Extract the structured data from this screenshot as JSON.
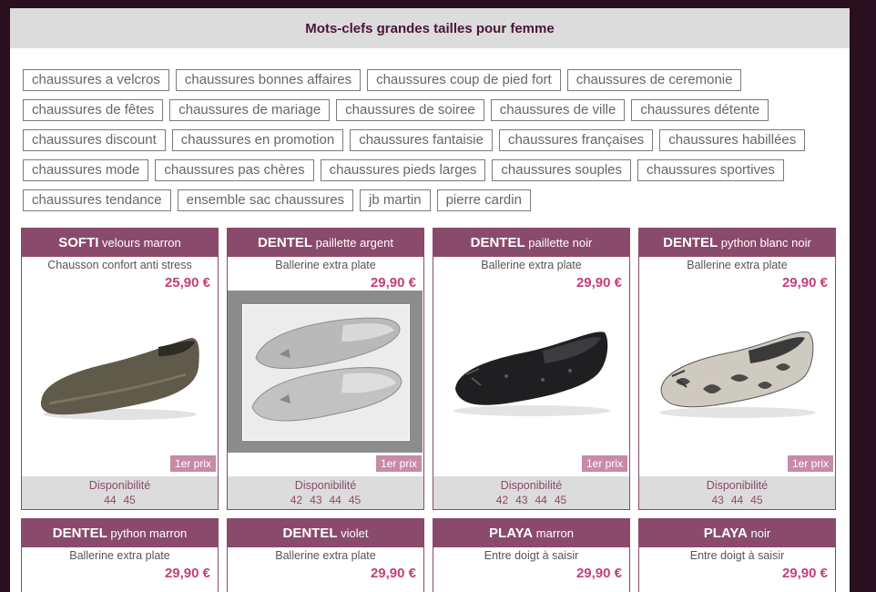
{
  "header": {
    "title": "Mots-clefs grandes tailles pour femme"
  },
  "tags": [
    "chaussures a velcros",
    "chaussures bonnes affaires",
    "chaussures coup de pied fort",
    "chaussures de ceremonie",
    "chaussures de fêtes",
    "chaussures de mariage",
    "chaussures de soiree",
    "chaussures de ville",
    "chaussures détente",
    "chaussures discount",
    "chaussures en promotion",
    "chaussures fantaisie",
    "chaussures françaises",
    "chaussures habillées",
    "chaussures mode",
    "chaussures pas chères",
    "chaussures pieds larges",
    "chaussures souples",
    "chaussures sportives",
    "chaussures tendance",
    "ensemble sac chaussures",
    "jb martin",
    "pierre cardin"
  ],
  "products": [
    {
      "brand": "SOFTI",
      "variant": "velours marron",
      "subtitle": "Chausson confort anti stress",
      "price": "25,90 €",
      "badge": "1er prix",
      "availability_label": "Disponibilité",
      "sizes": [
        "44",
        "45"
      ]
    },
    {
      "brand": "DENTEL",
      "variant": "paillette argent",
      "subtitle": "Ballerine extra plate",
      "price": "29,90 €",
      "badge": "1er prix",
      "availability_label": "Disponibilité",
      "sizes": [
        "42",
        "43",
        "44",
        "45"
      ]
    },
    {
      "brand": "DENTEL",
      "variant": "paillette noir",
      "subtitle": "Ballerine extra plate",
      "price": "29,90 €",
      "badge": "1er prix",
      "availability_label": "Disponibilité",
      "sizes": [
        "42",
        "43",
        "44",
        "45"
      ]
    },
    {
      "brand": "DENTEL",
      "variant": "python blanc noir",
      "subtitle": "Ballerine extra plate",
      "price": "29,90 €",
      "badge": "1er prix",
      "availability_label": "Disponibilité",
      "sizes": [
        "43",
        "44",
        "45"
      ]
    },
    {
      "brand": "DENTEL",
      "variant": "python marron",
      "subtitle": "Ballerine extra plate",
      "price": "29,90 €"
    },
    {
      "brand": "DENTEL",
      "variant": "violet",
      "subtitle": "Ballerine extra plate",
      "price": "29,90 €"
    },
    {
      "brand": "PLAYA",
      "variant": "marron",
      "subtitle": "Entre doigt à saisir",
      "price": "29,90 €"
    },
    {
      "brand": "PLAYA",
      "variant": "noir",
      "subtitle": "Entre doigt à saisir",
      "price": "29,90 €"
    }
  ],
  "colors": {
    "accent": "#8a4a6b",
    "price": "#c33f78",
    "badge": "#c98aa8",
    "background": "#2a0f1e"
  }
}
